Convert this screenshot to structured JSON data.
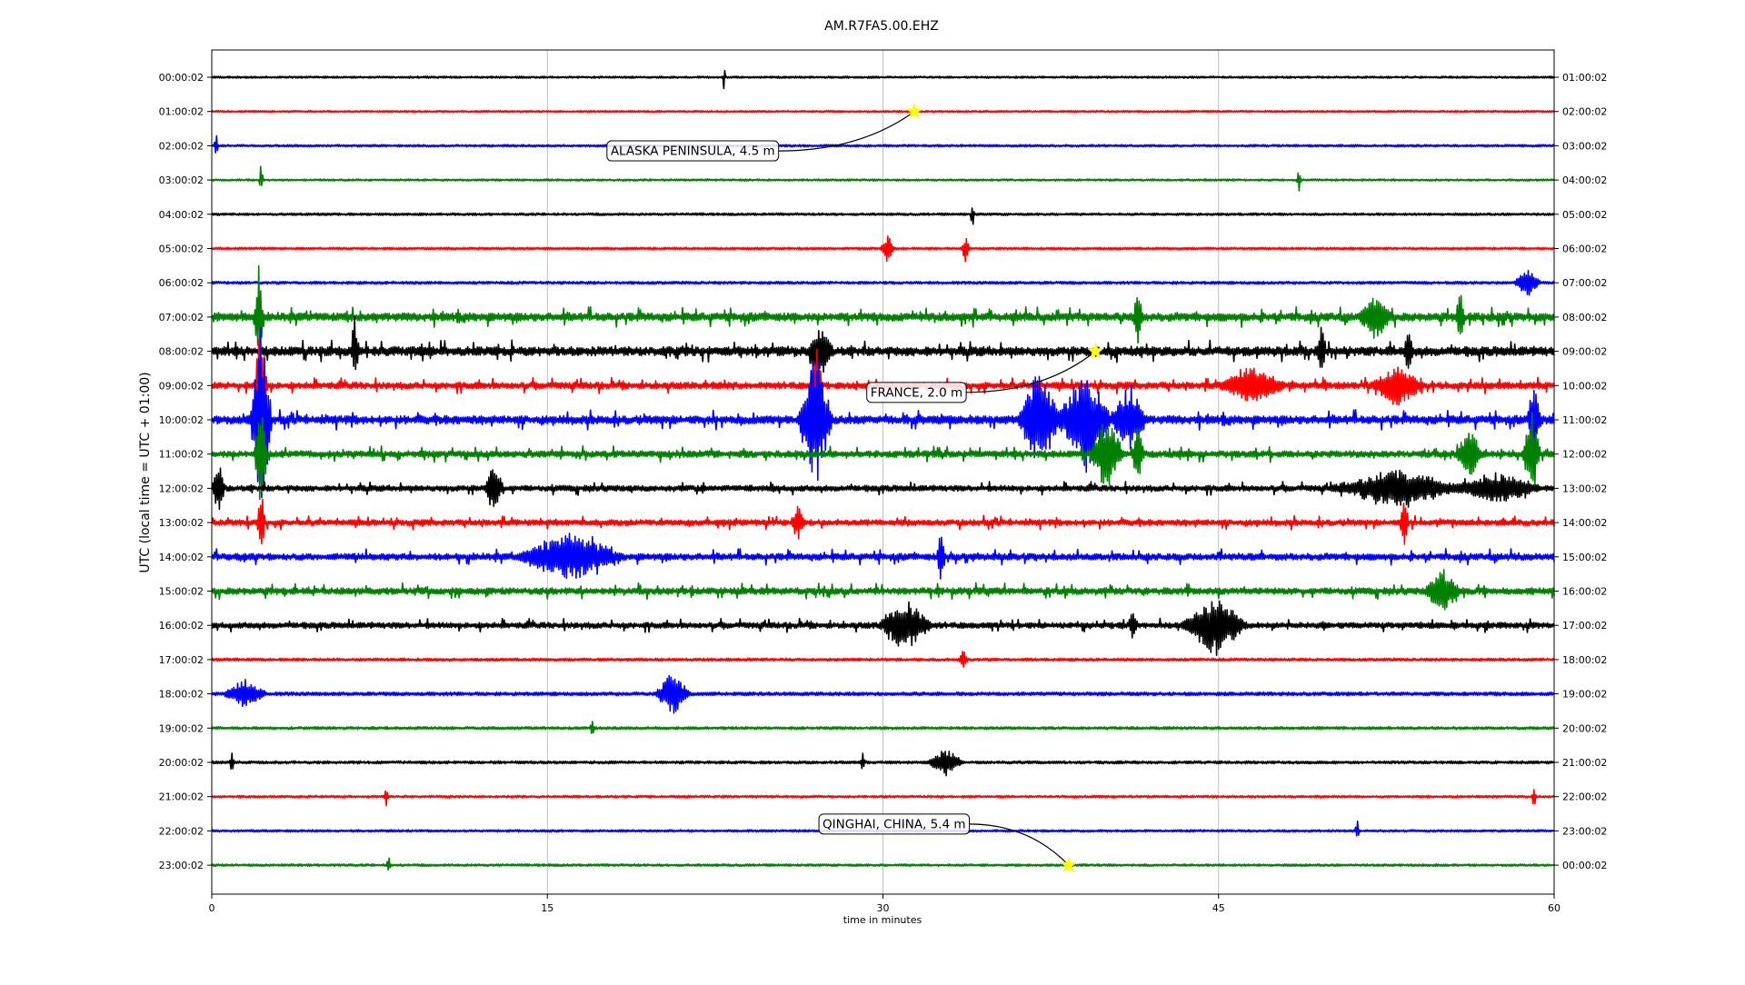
{
  "chart_data": {
    "type": "line",
    "title": "AM.R7FA5.00.EHZ",
    "xlabel": "time in minutes",
    "ylabel": "UTC (local time = UTC + 01:00)",
    "xlim": [
      0,
      60
    ],
    "x_ticks": [
      0,
      15,
      30,
      45,
      60
    ],
    "grid": true,
    "grid_axis": "x",
    "trace_colors": [
      "#000000",
      "#ff0000",
      "#0000ff",
      "#008000"
    ],
    "rows": [
      {
        "left": "00:00:02",
        "right": "01:00:02",
        "level": 0.25
      },
      {
        "left": "01:00:02",
        "right": "02:00:02",
        "level": 0.25
      },
      {
        "left": "02:00:02",
        "right": "03:00:02",
        "level": 0.3
      },
      {
        "left": "03:00:02",
        "right": "04:00:02",
        "level": 0.25
      },
      {
        "left": "04:00:02",
        "right": "05:00:02",
        "level": 0.3
      },
      {
        "left": "05:00:02",
        "right": "06:00:02",
        "level": 0.3
      },
      {
        "left": "06:00:02",
        "right": "07:00:02",
        "level": 0.35
      },
      {
        "left": "07:00:02",
        "right": "08:00:02",
        "level": 1.0
      },
      {
        "left": "08:00:02",
        "right": "09:00:02",
        "level": 1.1
      },
      {
        "left": "09:00:02",
        "right": "10:00:02",
        "level": 0.8
      },
      {
        "left": "10:00:02",
        "right": "11:00:02",
        "level": 1.0
      },
      {
        "left": "11:00:02",
        "right": "12:00:02",
        "level": 0.8
      },
      {
        "left": "12:00:02",
        "right": "13:00:02",
        "level": 0.7
      },
      {
        "left": "13:00:02",
        "right": "14:00:02",
        "level": 0.7
      },
      {
        "left": "14:00:02",
        "right": "15:00:02",
        "level": 0.8
      },
      {
        "left": "15:00:02",
        "right": "16:00:02",
        "level": 0.8
      },
      {
        "left": "16:00:02",
        "right": "17:00:02",
        "level": 0.7
      },
      {
        "left": "17:00:02",
        "right": "18:00:02",
        "level": 0.35
      },
      {
        "left": "18:00:02",
        "right": "19:00:02",
        "level": 0.45
      },
      {
        "left": "19:00:02",
        "right": "20:00:02",
        "level": 0.35
      },
      {
        "left": "20:00:02",
        "right": "21:00:02",
        "level": 0.35
      },
      {
        "left": "21:00:02",
        "right": "22:00:02",
        "level": 0.3
      },
      {
        "left": "22:00:02",
        "right": "23:00:02",
        "level": 0.3
      },
      {
        "left": "23:00:02",
        "right": "00:00:02",
        "level": 0.3
      }
    ],
    "events": [
      {
        "row": 1,
        "x": 31.4,
        "label": "ALASKA PENINSULA, 4.5 m",
        "label_x": 21.5,
        "label_row": 2.15
      },
      {
        "row": 8,
        "x": 39.5,
        "label": "FRANCE, 2.0 m",
        "label_x": 31.5,
        "label_row": 9.2
      },
      {
        "row": 23,
        "x": 38.3,
        "label": "QINGHAI, CHINA, 5.4 m",
        "label_x": 30.5,
        "label_row": 21.8
      }
    ],
    "bursts": [
      {
        "row": 0,
        "x": 22.9,
        "amp": 0.6,
        "dur": 0.05
      },
      {
        "row": 2,
        "x": 0.2,
        "amp": 0.5,
        "dur": 0.1
      },
      {
        "row": 3,
        "x": 2.2,
        "amp": 0.6,
        "dur": 0.1
      },
      {
        "row": 3,
        "x": 48.6,
        "amp": 0.4,
        "dur": 0.1
      },
      {
        "row": 4,
        "x": 34.0,
        "amp": 0.5,
        "dur": 0.1
      },
      {
        "row": 5,
        "x": 30.2,
        "amp": 0.5,
        "dur": 0.3
      },
      {
        "row": 5,
        "x": 33.7,
        "amp": 0.5,
        "dur": 0.2
      },
      {
        "row": 6,
        "x": 58.8,
        "amp": 0.5,
        "dur": 0.6
      },
      {
        "row": 7,
        "x": 2.1,
        "amp": 2.2,
        "dur": 0.2
      },
      {
        "row": 7,
        "x": 41.4,
        "amp": 1.2,
        "dur": 0.2
      },
      {
        "row": 7,
        "x": 52.0,
        "amp": 0.7,
        "dur": 0.8
      },
      {
        "row": 7,
        "x": 55.8,
        "amp": 1.0,
        "dur": 0.2
      },
      {
        "row": 8,
        "x": 6.4,
        "amp": 1.3,
        "dur": 0.2
      },
      {
        "row": 8,
        "x": 27.2,
        "amp": 0.9,
        "dur": 0.6
      },
      {
        "row": 8,
        "x": 49.6,
        "amp": 1.1,
        "dur": 0.2
      },
      {
        "row": 8,
        "x": 53.5,
        "amp": 0.8,
        "dur": 0.2
      },
      {
        "row": 9,
        "x": 2.2,
        "amp": 2.5,
        "dur": 0.3
      },
      {
        "row": 9,
        "x": 27.0,
        "amp": 1.7,
        "dur": 0.3
      },
      {
        "row": 9,
        "x": 46.5,
        "amp": 0.6,
        "dur": 1.5
      },
      {
        "row": 9,
        "x": 53.0,
        "amp": 0.7,
        "dur": 1.2
      },
      {
        "row": 10,
        "x": 2.2,
        "amp": 3.5,
        "dur": 0.5
      },
      {
        "row": 10,
        "x": 27.0,
        "amp": 2.5,
        "dur": 0.8
      },
      {
        "row": 10,
        "x": 37.0,
        "amp": 1.8,
        "dur": 1.0
      },
      {
        "row": 10,
        "x": 39.0,
        "amp": 2.0,
        "dur": 1.2
      },
      {
        "row": 10,
        "x": 41.0,
        "amp": 1.2,
        "dur": 0.8
      },
      {
        "row": 10,
        "x": 59.1,
        "amp": 1.5,
        "dur": 0.3
      },
      {
        "row": 11,
        "x": 2.2,
        "amp": 2.0,
        "dur": 0.3
      },
      {
        "row": 11,
        "x": 40.0,
        "amp": 1.3,
        "dur": 0.8
      },
      {
        "row": 11,
        "x": 41.4,
        "amp": 1.0,
        "dur": 0.3
      },
      {
        "row": 11,
        "x": 56.2,
        "amp": 1.0,
        "dur": 0.6
      },
      {
        "row": 11,
        "x": 59.0,
        "amp": 1.6,
        "dur": 0.4
      },
      {
        "row": 12,
        "x": 0.3,
        "amp": 1.0,
        "dur": 0.3
      },
      {
        "row": 12,
        "x": 12.6,
        "amp": 1.0,
        "dur": 0.4
      },
      {
        "row": 12,
        "x": 53.0,
        "amp": 0.6,
        "dur": 3.0
      },
      {
        "row": 12,
        "x": 57.5,
        "amp": 0.5,
        "dur": 2.0
      },
      {
        "row": 13,
        "x": 2.2,
        "amp": 1.5,
        "dur": 0.2
      },
      {
        "row": 13,
        "x": 26.2,
        "amp": 0.6,
        "dur": 0.3
      },
      {
        "row": 13,
        "x": 53.3,
        "amp": 1.0,
        "dur": 0.2
      },
      {
        "row": 14,
        "x": 16.0,
        "amp": 0.8,
        "dur": 2.5
      },
      {
        "row": 14,
        "x": 32.6,
        "amp": 1.0,
        "dur": 0.2
      },
      {
        "row": 15,
        "x": 55.0,
        "amp": 0.8,
        "dur": 0.8
      },
      {
        "row": 16,
        "x": 31.0,
        "amp": 0.9,
        "dur": 1.2
      },
      {
        "row": 16,
        "x": 44.8,
        "amp": 1.0,
        "dur": 1.5
      },
      {
        "row": 16,
        "x": 41.2,
        "amp": 0.6,
        "dur": 0.2
      },
      {
        "row": 17,
        "x": 33.6,
        "amp": 0.4,
        "dur": 0.2
      },
      {
        "row": 18,
        "x": 20.6,
        "amp": 0.8,
        "dur": 0.8
      },
      {
        "row": 18,
        "x": 1.5,
        "amp": 0.5,
        "dur": 1.0
      },
      {
        "row": 19,
        "x": 17.0,
        "amp": 0.4,
        "dur": 0.1
      },
      {
        "row": 20,
        "x": 0.9,
        "amp": 0.5,
        "dur": 0.1
      },
      {
        "row": 20,
        "x": 29.1,
        "amp": 0.5,
        "dur": 0.1
      },
      {
        "row": 20,
        "x": 32.8,
        "amp": 0.5,
        "dur": 0.8
      },
      {
        "row": 21,
        "x": 7.8,
        "amp": 0.4,
        "dur": 0.1
      },
      {
        "row": 21,
        "x": 59.1,
        "amp": 0.4,
        "dur": 0.1
      },
      {
        "row": 22,
        "x": 51.2,
        "amp": 0.4,
        "dur": 0.1
      },
      {
        "row": 23,
        "x": 7.9,
        "amp": 0.4,
        "dur": 0.1
      }
    ]
  }
}
